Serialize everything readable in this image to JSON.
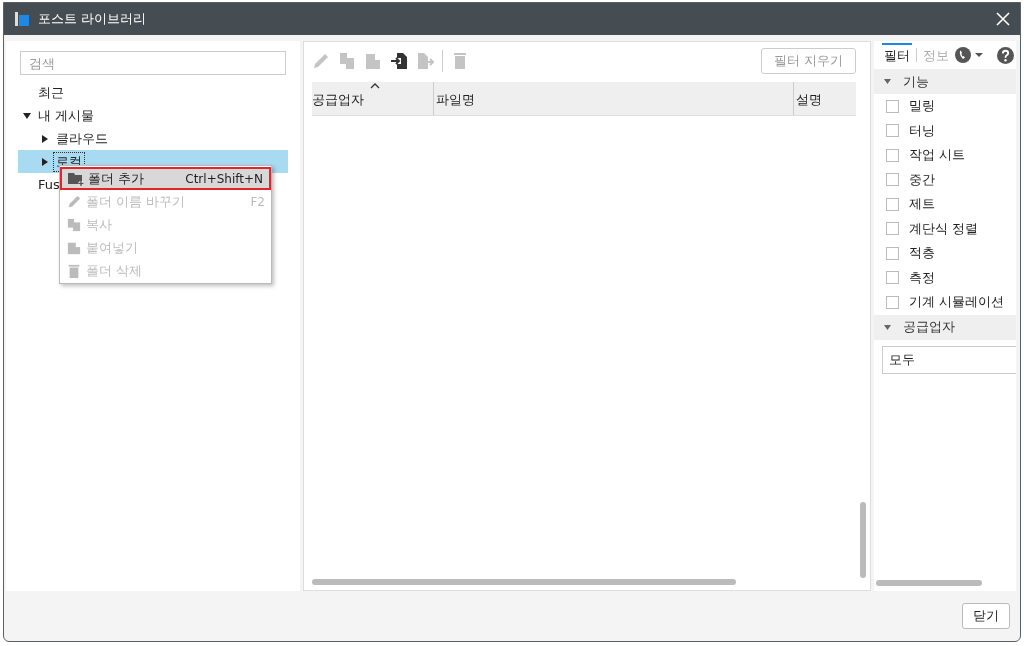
{
  "window": {
    "title": "포스트 라이브러리"
  },
  "search": {
    "placeholder": "검색"
  },
  "tree": [
    {
      "label": "최근",
      "selected": false
    },
    {
      "label": "내 게시물",
      "expanded": true,
      "selected": false,
      "children": [
        {
          "label": "클라우드",
          "expanded": false,
          "selected": false
        },
        {
          "label": "로컬",
          "expanded": false,
          "selected": true
        }
      ]
    },
    {
      "label": "Fus",
      "selected": false
    }
  ],
  "context_menu": [
    {
      "label": "폴더 추가",
      "shortcut": "Ctrl+Shift+N",
      "disabled": false,
      "selected": true
    },
    {
      "label": "폴더 이름 바꾸기",
      "shortcut": "F2",
      "disabled": true,
      "selected": false
    },
    {
      "label": "복사",
      "disabled": true,
      "selected": false
    },
    {
      "label": "붙여넣기",
      "disabled": true,
      "selected": false
    },
    {
      "label": "폴더 삭제",
      "disabled": true,
      "selected": false
    }
  ],
  "toolbar": [
    {
      "disabled": true
    },
    {
      "disabled": true
    },
    {
      "disabled": true
    },
    {
      "disabled": false
    },
    {
      "disabled": true
    },
    {
      "disabled": true
    }
  ],
  "clear_filter_button": {
    "label": "필터 지우기",
    "disabled": true
  },
  "table": {
    "columns": [
      {
        "label": "공급업자",
        "sorted": true
      },
      {
        "label": "파일명",
        "sorted": false
      },
      {
        "label": "설명",
        "sorted": false
      }
    ]
  },
  "side_tabs": [
    {
      "label": "필터",
      "selected": true
    },
    {
      "label": "정보",
      "selected": false
    }
  ],
  "function_section": {
    "title": "기능",
    "expanded": true,
    "items": [
      {
        "label": "밀링",
        "checked": false
      },
      {
        "label": "터닝",
        "checked": false
      },
      {
        "label": "작업 시트",
        "checked": false
      },
      {
        "label": "중간",
        "checked": false
      },
      {
        "label": "제트",
        "checked": false
      },
      {
        "label": "계단식 정렬",
        "checked": false
      },
      {
        "label": "적층",
        "checked": false
      },
      {
        "label": "측정",
        "checked": false
      },
      {
        "label": "기계 시뮬레이션",
        "checked": false
      }
    ]
  },
  "vendor_section": {
    "title": "공급업자",
    "expanded": true,
    "value": "모두"
  },
  "close_button": "닫기"
}
